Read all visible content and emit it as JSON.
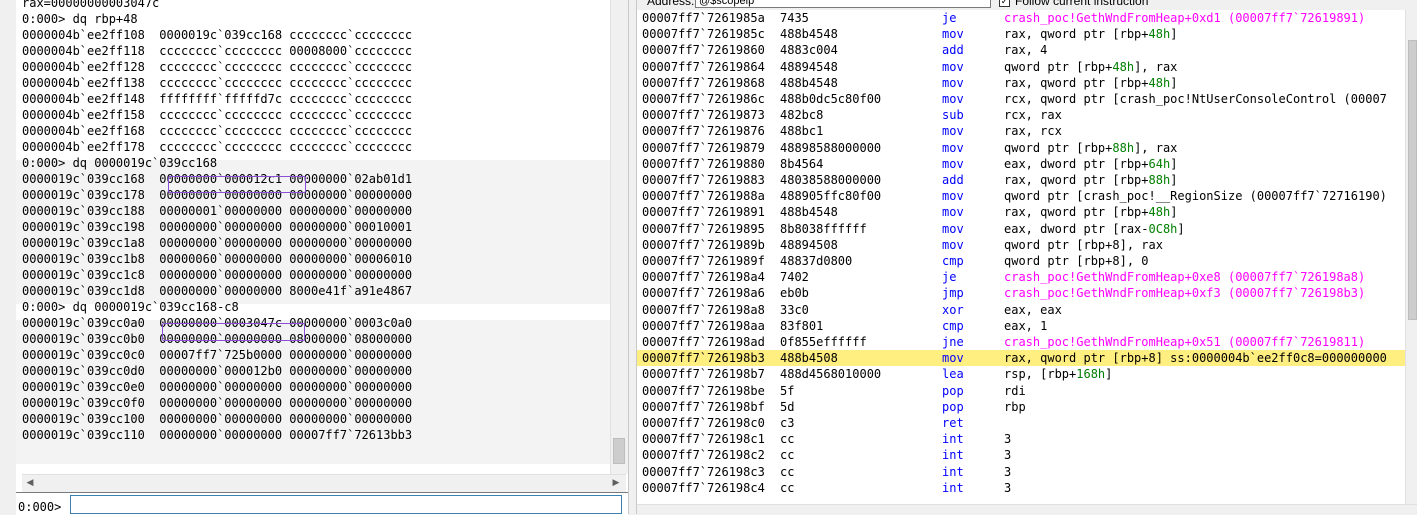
{
  "command_window": {
    "prompt": "0:000>",
    "input_value": "",
    "output_lines": [
      "rax=00000000003047c",
      "0:000> dq rbp+48",
      "0000004b`ee2ff108  0000019c`039cc168 cccccccc`cccccccc",
      "0000004b`ee2ff118  cccccccc`cccccccc 00008000`cccccccc",
      "0000004b`ee2ff128  cccccccc`cccccccc cccccccc`cccccccc",
      "0000004b`ee2ff138  cccccccc`cccccccc cccccccc`cccccccc",
      "0000004b`ee2ff148  ffffffff`fffffd7c cccccccc`cccccccc",
      "0000004b`ee2ff158  cccccccc`cccccccc cccccccc`cccccccc",
      "0000004b`ee2ff168  cccccccc`cccccccc cccccccc`cccccccc",
      "0000004b`ee2ff178  cccccccc`cccccccc cccccccc`cccccccc",
      "0:000> dq 0000019c`039cc168",
      "0000019c`039cc168  00000000`000012c1 00000000`02ab01d1",
      "0000019c`039cc178  00000000`00000000 00000000`00000000",
      "0000019c`039cc188  00000001`00000000 00000000`00000000",
      "0000019c`039cc198  00000000`00000000 00000000`00010001",
      "0000019c`039cc1a8  00000000`00000000 00000000`00000000",
      "0000019c`039cc1b8  00000060`00000000 00000000`00006010",
      "0000019c`039cc1c8  00000000`00000000 00000000`00000000",
      "0000019c`039cc1d8  00000000`00000000 8000e41f`a91e4867",
      "0:000> dq 0000019c`039cc168-c8",
      "0000019c`039cc0a0  00000000`0003047c 00000000`0003c0a0",
      "0000019c`039cc0b0  00000000`00000000 08000000`08000000",
      "0000019c`039cc0c0  00007ff7`725b0000 00000000`00000000",
      "0000019c`039cc0d0  00000000`000012b0 00000000`00000000",
      "0000019c`039cc0e0  00000000`00000000 00000000`00000000",
      "0000019c`039cc0f0  00000000`00000000 00000000`00000000",
      "0000019c`039cc100  00000000`00000000 00000000`00000000",
      "0000019c`039cc110  00000000`00000000 00007ff7`72613bb3"
    ]
  },
  "disassembly_window": {
    "address_label": "Address:",
    "address_value": "@$scopeip",
    "follow_label": "Follow current instruction",
    "rows": [
      {
        "addr": "00007ff7`7261985a",
        "bytes": "7435",
        "mn": "je",
        "ops": [
          {
            "t": "crash_poc!GethWndFromHeap+0xd1 (00007ff7`72619891)",
            "c": "sym"
          }
        ]
      },
      {
        "addr": "00007ff7`7261985c",
        "bytes": "488b4548",
        "mn": "mov",
        "ops": [
          {
            "t": "rax, qword ptr [rbp+",
            "c": "plain"
          },
          {
            "t": "48h",
            "c": "num"
          },
          {
            "t": "]",
            "c": "plain"
          }
        ]
      },
      {
        "addr": "00007ff7`72619860",
        "bytes": "4883c004",
        "mn": "add",
        "ops": [
          {
            "t": "rax, 4",
            "c": "plain"
          }
        ]
      },
      {
        "addr": "00007ff7`72619864",
        "bytes": "48894548",
        "mn": "mov",
        "ops": [
          {
            "t": "qword ptr [rbp+",
            "c": "plain"
          },
          {
            "t": "48h",
            "c": "num"
          },
          {
            "t": "], rax",
            "c": "plain"
          }
        ]
      },
      {
        "addr": "00007ff7`72619868",
        "bytes": "488b4548",
        "mn": "mov",
        "ops": [
          {
            "t": "rax, qword ptr [rbp+",
            "c": "plain"
          },
          {
            "t": "48h",
            "c": "num"
          },
          {
            "t": "]",
            "c": "plain"
          }
        ]
      },
      {
        "addr": "00007ff7`7261986c",
        "bytes": "488b0dc5c80f00",
        "mn": "mov",
        "ops": [
          {
            "t": "rcx, qword ptr [crash_poc!NtUserConsoleControl (00007",
            "c": "plain"
          }
        ]
      },
      {
        "addr": "00007ff7`72619873",
        "bytes": "482bc8",
        "mn": "sub",
        "ops": [
          {
            "t": "rcx, rax",
            "c": "plain"
          }
        ]
      },
      {
        "addr": "00007ff7`72619876",
        "bytes": "488bc1",
        "mn": "mov",
        "ops": [
          {
            "t": "rax, rcx",
            "c": "plain"
          }
        ]
      },
      {
        "addr": "00007ff7`72619879",
        "bytes": "48898588000000",
        "mn": "mov",
        "ops": [
          {
            "t": "qword ptr [rbp+",
            "c": "plain"
          },
          {
            "t": "88h",
            "c": "num"
          },
          {
            "t": "], rax",
            "c": "plain"
          }
        ]
      },
      {
        "addr": "00007ff7`72619880",
        "bytes": "8b4564",
        "mn": "mov",
        "ops": [
          {
            "t": "eax, dword ptr [rbp+",
            "c": "plain"
          },
          {
            "t": "64h",
            "c": "num"
          },
          {
            "t": "]",
            "c": "plain"
          }
        ]
      },
      {
        "addr": "00007ff7`72619883",
        "bytes": "48038588000000",
        "mn": "add",
        "ops": [
          {
            "t": "rax, qword ptr [rbp+",
            "c": "plain"
          },
          {
            "t": "88h",
            "c": "num"
          },
          {
            "t": "]",
            "c": "plain"
          }
        ]
      },
      {
        "addr": "00007ff7`7261988a",
        "bytes": "488905ffc80f00",
        "mn": "mov",
        "ops": [
          {
            "t": "qword ptr [crash_poc!__RegionSize (00007ff7`72716190)",
            "c": "plain"
          }
        ]
      },
      {
        "addr": "00007ff7`72619891",
        "bytes": "488b4548",
        "mn": "mov",
        "ops": [
          {
            "t": "rax, qword ptr [rbp+",
            "c": "plain"
          },
          {
            "t": "48h",
            "c": "num"
          },
          {
            "t": "]",
            "c": "plain"
          }
        ]
      },
      {
        "addr": "00007ff7`72619895",
        "bytes": "8b8038ffffff",
        "mn": "mov",
        "ops": [
          {
            "t": "eax, dword ptr [rax-",
            "c": "plain"
          },
          {
            "t": "0C8h",
            "c": "num"
          },
          {
            "t": "]",
            "c": "plain"
          }
        ]
      },
      {
        "addr": "00007ff7`7261989b",
        "bytes": "48894508",
        "mn": "mov",
        "ops": [
          {
            "t": "qword ptr [rbp+8], rax",
            "c": "plain"
          }
        ]
      },
      {
        "addr": "00007ff7`7261989f",
        "bytes": "48837d0800",
        "mn": "cmp",
        "ops": [
          {
            "t": "qword ptr [rbp+8], 0",
            "c": "plain"
          }
        ]
      },
      {
        "addr": "00007ff7`726198a4",
        "bytes": "7402",
        "mn": "je",
        "ops": [
          {
            "t": "crash_poc!GethWndFromHeap+0xe8 (00007ff7`726198a8)",
            "c": "sym"
          }
        ]
      },
      {
        "addr": "00007ff7`726198a6",
        "bytes": "eb0b",
        "mn": "jmp",
        "ops": [
          {
            "t": "crash_poc!GethWndFromHeap+0xf3 (00007ff7`726198b3)",
            "c": "sym"
          }
        ]
      },
      {
        "addr": "00007ff7`726198a8",
        "bytes": "33c0",
        "mn": "xor",
        "ops": [
          {
            "t": "eax, eax",
            "c": "plain"
          }
        ]
      },
      {
        "addr": "00007ff7`726198aa",
        "bytes": "83f801",
        "mn": "cmp",
        "ops": [
          {
            "t": "eax, 1",
            "c": "plain"
          }
        ]
      },
      {
        "addr": "00007ff7`726198ad",
        "bytes": "0f855effffff",
        "mn": "jne",
        "ops": [
          {
            "t": "crash_poc!GethWndFromHeap+0x51 (00007ff7`72619811)",
            "c": "sym"
          }
        ]
      },
      {
        "addr": "00007ff7`726198b3",
        "bytes": "488b4508",
        "mn": "mov",
        "current": true,
        "ops": [
          {
            "t": "rax, qword ptr [rbp+8] ss:0000004b`ee2ff0c8=000000000",
            "c": "plain"
          }
        ]
      },
      {
        "addr": "00007ff7`726198b7",
        "bytes": "488d4568010000",
        "mn": "lea",
        "ops": [
          {
            "t": "rsp, [rbp+",
            "c": "plain"
          },
          {
            "t": "168h",
            "c": "num"
          },
          {
            "t": "]",
            "c": "plain"
          }
        ]
      },
      {
        "addr": "00007ff7`726198be",
        "bytes": "5f",
        "mn": "pop",
        "ops": [
          {
            "t": "rdi",
            "c": "plain"
          }
        ]
      },
      {
        "addr": "00007ff7`726198bf",
        "bytes": "5d",
        "mn": "pop",
        "ops": [
          {
            "t": "rbp",
            "c": "plain"
          }
        ]
      },
      {
        "addr": "00007ff7`726198c0",
        "bytes": "c3",
        "mn": "ret",
        "ops": []
      },
      {
        "addr": "00007ff7`726198c1",
        "bytes": "cc",
        "mn": "int",
        "ops": [
          {
            "t": "3",
            "c": "plain"
          }
        ]
      },
      {
        "addr": "00007ff7`726198c2",
        "bytes": "cc",
        "mn": "int",
        "ops": [
          {
            "t": "3",
            "c": "plain"
          }
        ]
      },
      {
        "addr": "00007ff7`726198c3",
        "bytes": "cc",
        "mn": "int",
        "ops": [
          {
            "t": "3",
            "c": "plain"
          }
        ]
      },
      {
        "addr": "00007ff7`726198c4",
        "bytes": "cc",
        "mn": "int",
        "ops": [
          {
            "t": "3",
            "c": "plain"
          }
        ]
      }
    ]
  },
  "colors": {
    "mnemonic": "#0000ff",
    "symbol": "#ff00ff",
    "number": "#008000",
    "current_line": "#ffee80",
    "highlight_box": "#8a50d8",
    "output_band": "#f3f3f3"
  },
  "icons": {
    "scroll_left": "triangle-left-icon",
    "scroll_right": "triangle-right-icon",
    "scroll_up": "triangle-up-icon",
    "checkbox": "check-icon"
  }
}
